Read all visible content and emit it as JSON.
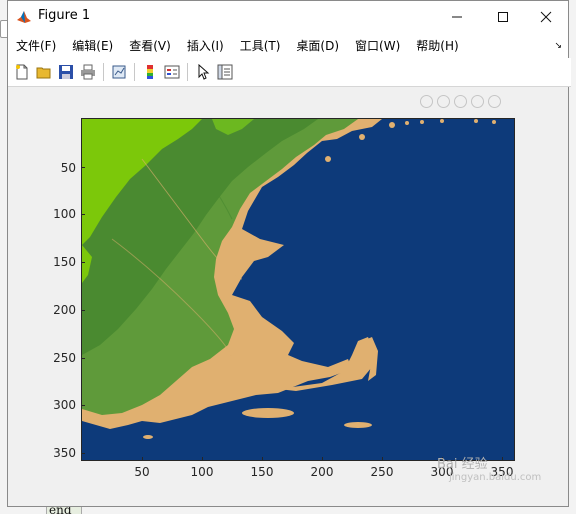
{
  "window": {
    "title": "Figure 1",
    "controls": [
      "minimize",
      "maximize",
      "close"
    ]
  },
  "menubar": {
    "items": [
      "文件(F)",
      "编辑(E)",
      "查看(V)",
      "插入(I)",
      "工具(T)",
      "桌面(D)",
      "窗口(W)",
      "帮助(H)"
    ]
  },
  "toolbar": {
    "buttons": [
      "new-figure",
      "open-file",
      "save",
      "print",
      "link-plot",
      "insert-colorbar",
      "insert-legend",
      "edit-plot",
      "property-inspector"
    ]
  },
  "background": {
    "partial_text": "end"
  },
  "plot": {
    "y_ticks": [
      "50",
      "100",
      "150",
      "200",
      "250",
      "300",
      "350"
    ],
    "x_ticks": [
      "50",
      "100",
      "150",
      "200",
      "250",
      "300",
      "350"
    ],
    "colors": {
      "ocean": "#0d3a7a",
      "coast": "#e0b070",
      "lowland": "#5f9a3a",
      "highland": "#7cc80a",
      "forest": "#4a8a30"
    }
  },
  "watermark": {
    "text": "Bai 经验",
    "sub": "jingyan.baidu.com"
  }
}
